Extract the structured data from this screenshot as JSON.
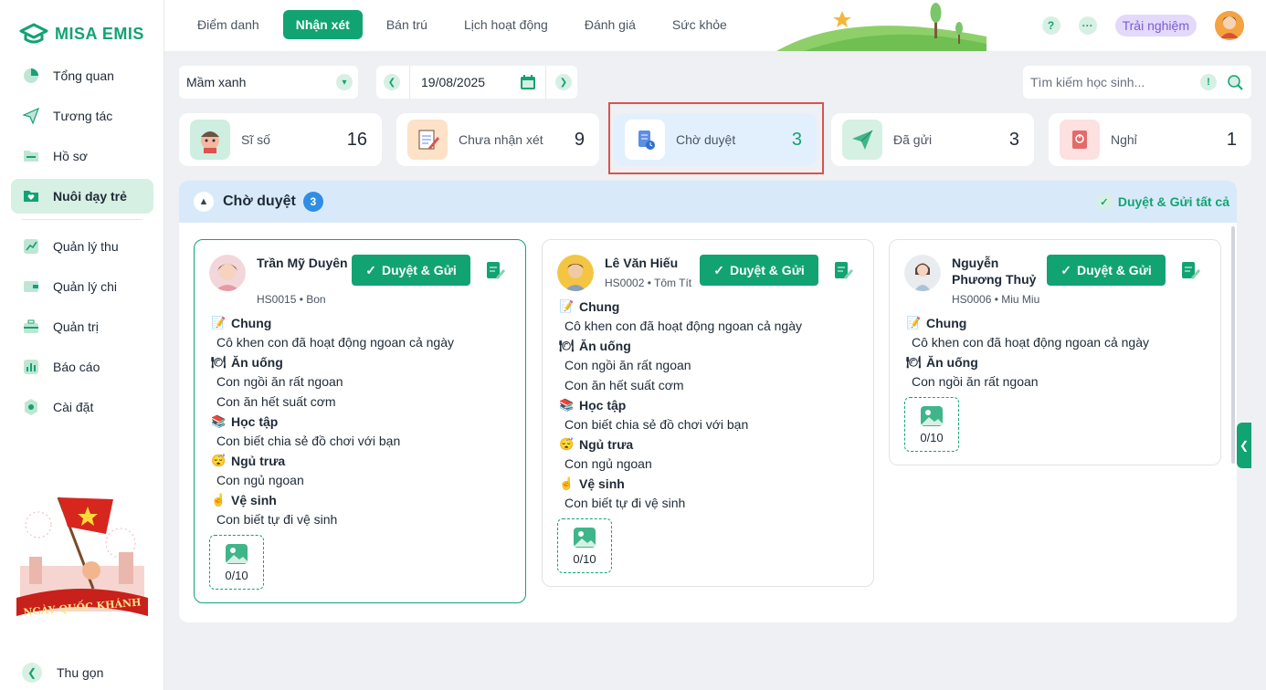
{
  "brand": {
    "name": "MISA EMIS"
  },
  "sidebar": {
    "items": [
      {
        "label": "Tổng quan",
        "icon": "pie-chart-icon"
      },
      {
        "label": "Tương tác",
        "icon": "paper-plane-icon"
      },
      {
        "label": "Hồ sơ",
        "icon": "folder-icon"
      },
      {
        "label": "Nuôi dạy trẻ",
        "icon": "heart-folder-icon",
        "active": true
      },
      {
        "label": "Quản lý thu",
        "icon": "trend-chart-icon"
      },
      {
        "label": "Quản lý chi",
        "icon": "wallet-icon"
      },
      {
        "label": "Quản trị",
        "icon": "briefcase-icon"
      },
      {
        "label": "Báo cáo",
        "icon": "bar-chart-icon"
      },
      {
        "label": "Cài đặt",
        "icon": "gear-icon"
      }
    ],
    "banner_text": "NGÀY QUỐC KHÁNH",
    "collapse_label": "Thu gọn"
  },
  "topbar": {
    "tabs": [
      "Điểm danh",
      "Nhận xét",
      "Bán trú",
      "Lịch hoạt động",
      "Đánh giá",
      "Sức khỏe"
    ],
    "active_tab": "Nhận xét",
    "help": "?",
    "more": "···",
    "trial_label": "Trải nghiệm"
  },
  "filters": {
    "class_name": "Mầm xanh",
    "date": "19/08/2025",
    "search_placeholder": "Tìm kiếm học sinh...",
    "search_info": "!"
  },
  "stats": [
    {
      "label": "Sĩ số",
      "value": "16",
      "icon": "child-face-icon",
      "color": "#cdeee0"
    },
    {
      "label": "Chưa nhận xét",
      "value": "9",
      "icon": "notepad-pen-icon",
      "color": "#fde2c8"
    },
    {
      "label": "Chờ duyệt",
      "value": "3",
      "icon": "document-clock-icon",
      "color": "#ffffff",
      "selected": true
    },
    {
      "label": "Đã gửi",
      "value": "3",
      "icon": "paper-plane-icon",
      "color": "#d7f0e4"
    },
    {
      "label": "Nghỉ",
      "value": "1",
      "icon": "power-book-icon",
      "color": "#fde0e0"
    }
  ],
  "panel": {
    "title": "Chờ duyệt",
    "count": "3",
    "approve_all": "Duyệt & Gửi tất cả"
  },
  "cards": [
    {
      "name": "Trần Mỹ Duyên",
      "code": "HS0015 • Bon",
      "approve": "Duyệt & Gửi",
      "photo": "0/10",
      "sections": [
        {
          "title": "Chung",
          "icon": "📝",
          "lines": [
            "Cô khen con đã hoạt động ngoan cả ngày"
          ]
        },
        {
          "title": "Ăn uống",
          "icon": "🍽",
          "lines": [
            "Con ngồi ăn rất ngoan",
            "Con ăn hết suất cơm"
          ]
        },
        {
          "title": "Học tập",
          "icon": "📚",
          "lines": [
            "Con biết chia sẻ đồ chơi với bạn"
          ]
        },
        {
          "title": "Ngủ trưa",
          "icon": "😴",
          "lines": [
            "Con ngủ ngoan"
          ]
        },
        {
          "title": "Vệ sinh",
          "icon": "☝",
          "lines": [
            "Con biết tự đi vệ sinh"
          ]
        }
      ]
    },
    {
      "name": "Lê Văn Hiếu",
      "code": "HS0002 • Tôm Tít",
      "approve": "Duyệt & Gửi",
      "photo": "0/10",
      "sections": [
        {
          "title": "Chung",
          "icon": "📝",
          "lines": [
            "Cô khen con đã hoạt động ngoan cả ngày"
          ]
        },
        {
          "title": "Ăn uống",
          "icon": "🍽",
          "lines": [
            "Con ngồi ăn rất ngoan",
            "Con ăn hết suất cơm"
          ]
        },
        {
          "title": "Học tập",
          "icon": "📚",
          "lines": [
            "Con biết chia sẻ đồ chơi với bạn"
          ]
        },
        {
          "title": "Ngủ trưa",
          "icon": "😴",
          "lines": [
            "Con ngủ ngoan"
          ]
        },
        {
          "title": "Vệ sinh",
          "icon": "☝",
          "lines": [
            "Con biết tự đi vệ sinh"
          ]
        }
      ]
    },
    {
      "name": "Nguyễn Phương Thuỷ",
      "code": "HS0006 • Miu Miu",
      "approve": "Duyệt & Gửi",
      "photo": "0/10",
      "sections": [
        {
          "title": "Chung",
          "icon": "📝",
          "lines": [
            "Cô khen con đã hoạt động ngoan cả ngày"
          ]
        },
        {
          "title": "Ăn uống",
          "icon": "🍽",
          "lines": [
            "Con ngồi ăn rất ngoan"
          ]
        }
      ]
    }
  ],
  "colors": {
    "accent": "#12a372",
    "badge": "#2f8de4",
    "highlight": "#d9534f",
    "trial": "#7b5bd6"
  }
}
